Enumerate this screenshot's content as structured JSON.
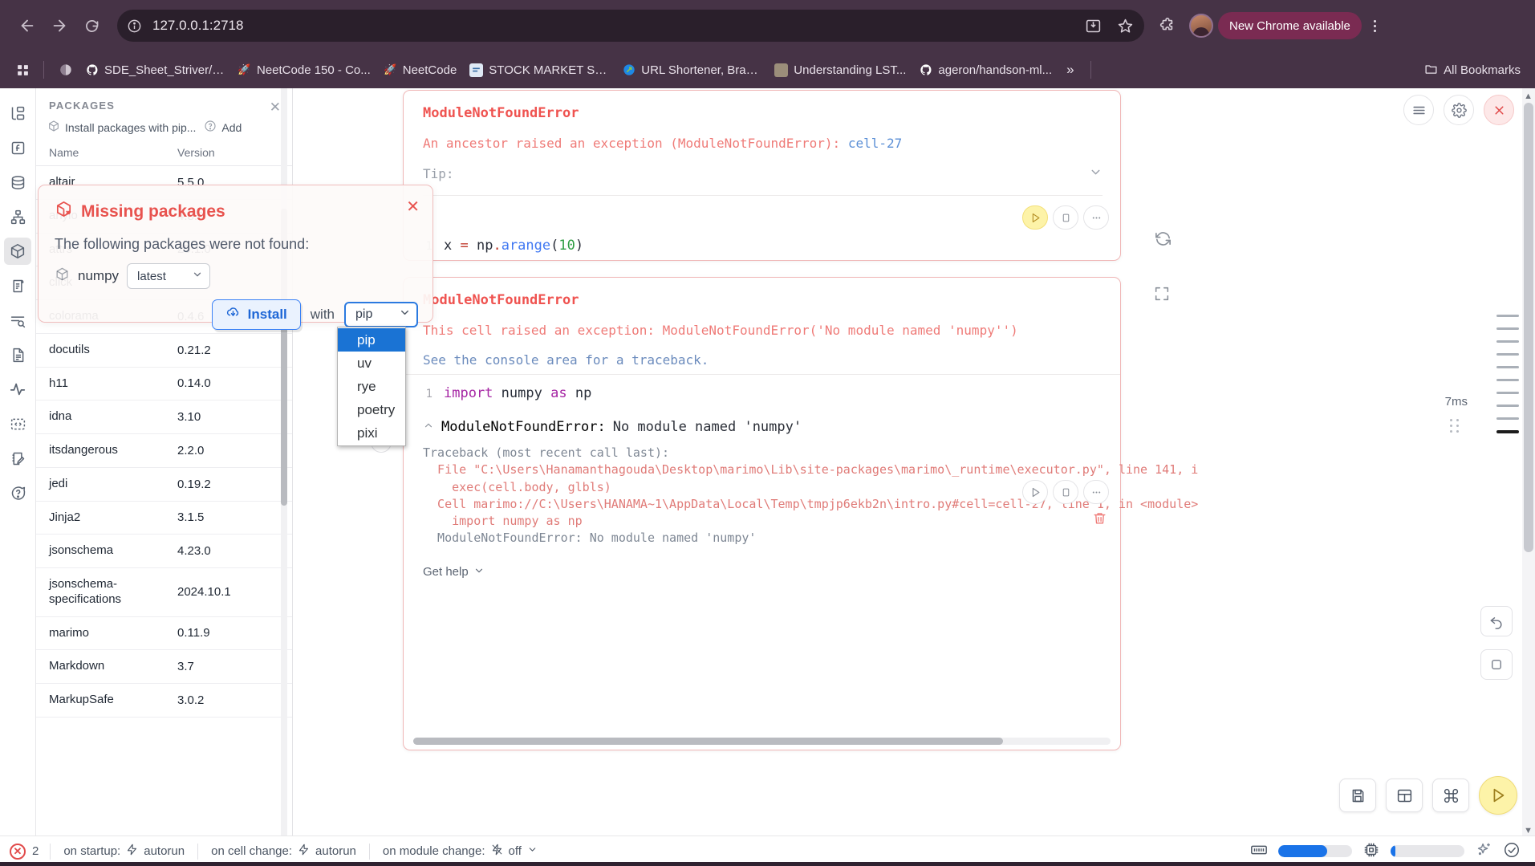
{
  "browser": {
    "url": "127.0.0.1:2718",
    "nav": {
      "back": "back-arrow",
      "forward": "forward-arrow",
      "reload": "reload",
      "site_info": "site-information"
    },
    "new_chrome_label": "New Chrome available",
    "bookmarks": [
      {
        "label": "SDE_Sheet_Striver/D...",
        "icon": "github-icon"
      },
      {
        "label": "NeetCode 150 - Co...",
        "icon": "rocket-icon"
      },
      {
        "label": "NeetCode",
        "icon": "rocket-icon"
      },
      {
        "label": "STOCK MARKET SU...",
        "icon": "doc-icon"
      },
      {
        "label": "URL Shortener, Bran...",
        "icon": "link-icon"
      },
      {
        "label": "Understanding LST...",
        "icon": "image-icon"
      },
      {
        "label": "ageron/handson-ml...",
        "icon": "github-icon"
      }
    ],
    "overflow_label": "»",
    "all_bookmarks_label": "All Bookmarks"
  },
  "sidebar": {
    "items": [
      {
        "name": "file-explorer-icon",
        "active": false
      },
      {
        "name": "variables-icon",
        "active": false
      },
      {
        "name": "data-sources-icon",
        "active": false
      },
      {
        "name": "dependency-graph-icon",
        "active": false
      },
      {
        "name": "packages-icon",
        "active": true
      },
      {
        "name": "documentation-icon",
        "active": false
      },
      {
        "name": "outline-search-icon",
        "active": false
      },
      {
        "name": "notebook-file-icon",
        "active": false
      },
      {
        "name": "tracing-icon",
        "active": false
      },
      {
        "name": "snippets-code-icon",
        "active": false
      },
      {
        "name": "scratchpad-icon",
        "active": false
      },
      {
        "name": "help-icon",
        "active": false
      }
    ]
  },
  "packages_panel": {
    "title": "PACKAGES",
    "install_action": "Install packages with pip...",
    "add_action": "Add",
    "columns": {
      "name": "Name",
      "version": "Version"
    },
    "rows": [
      {
        "name": "altair",
        "version": "5.5.0"
      },
      {
        "name": "anyio",
        "version": "4.8.0"
      },
      {
        "name": "attrs",
        "version": "25.1.0"
      },
      {
        "name": "click",
        "version": "8.1.8"
      },
      {
        "name": "colorama",
        "version": "0.4.6"
      },
      {
        "name": "docutils",
        "version": "0.21.2"
      },
      {
        "name": "h11",
        "version": "0.14.0"
      },
      {
        "name": "idna",
        "version": "3.10"
      },
      {
        "name": "itsdangerous",
        "version": "2.2.0"
      },
      {
        "name": "jedi",
        "version": "0.19.2"
      },
      {
        "name": "Jinja2",
        "version": "3.1.5"
      },
      {
        "name": "jsonschema",
        "version": "4.23.0"
      },
      {
        "name": "jsonschema-specifications",
        "version": "2024.10.1"
      },
      {
        "name": "marimo",
        "version": "0.11.9"
      },
      {
        "name": "Markdown",
        "version": "3.7"
      },
      {
        "name": "MarkupSafe",
        "version": "3.0.2"
      }
    ]
  },
  "modal": {
    "title": "Missing packages",
    "subtitle": "The following packages were not found:",
    "package_name": "numpy",
    "version_value": "latest",
    "install_label": "Install",
    "with_label": "with",
    "package_manager_value": "pip",
    "package_manager_options": [
      "pip",
      "uv",
      "rye",
      "poetry",
      "pixi"
    ],
    "close_label": "✕",
    "accent": "#e8534f"
  },
  "notebook": {
    "cell_top": {
      "error_title": "ModuleNotFoundError",
      "error_message_prefix": "An ancestor raised an exception (ModuleNotFoundError): ",
      "error_cell_ref": "cell-27",
      "tip_label": "Tip:",
      "code": "x = np.arange(10)",
      "line_number": "1"
    },
    "cell_bottom": {
      "error_title": "ModuleNotFoundError",
      "error_message": "This cell raised an exception: ModuleNotFoundError('No module named 'numpy'')",
      "console_hint": "See the console area for a traceback.",
      "line_number": "1",
      "code_import": "import",
      "code_module": "numpy",
      "code_as": "as",
      "code_alias": "np",
      "elapsed": "7ms",
      "traceback_header_error": "ModuleNotFoundError:",
      "traceback_header_message": "No module named 'numpy'",
      "traceback_lines": [
        "Traceback (most recent call last):",
        "  File \"C:\\Users\\Hanamanthagouda\\Desktop\\marimo\\Lib\\site-packages\\marimo\\_runtime\\executor.py\", line 141, i",
        "    exec(cell.body, glbls)",
        "  Cell marimo://C:\\Users\\HANAMA~1\\AppData\\Local\\Temp\\tmpjp6ekb2n\\intro.py#cell=cell-27, line 1, in <module>",
        "    import numpy as np",
        "  ModuleNotFoundError: No module named 'numpy'"
      ],
      "get_help_label": "Get help"
    },
    "buttons": {
      "menu": "hamburger-menu",
      "settings": "gear",
      "close": "close",
      "refresh": "refresh",
      "expand": "expand",
      "run_cell": "run",
      "stop_cell": "stop",
      "more": "more-options",
      "delete_cell": "delete",
      "add_cell": "+",
      "save": "save",
      "layout": "layout",
      "command": "command-palette",
      "run_all": "run-all",
      "undo": "undo"
    }
  },
  "statusbar": {
    "error_count": "2",
    "on_startup_label": "on startup:",
    "on_startup_value": "autorun",
    "on_cell_change_label": "on cell change:",
    "on_cell_change_value": "autorun",
    "on_module_change_label": "on module change:",
    "on_module_change_value": "off",
    "ram_icon": "ram-icon",
    "ram_percent": 66,
    "cpu_icon": "cpu-icon",
    "cpu_percent": 6,
    "ai_icon": "sparkles-icon",
    "status_icon": "check-circle-icon"
  }
}
